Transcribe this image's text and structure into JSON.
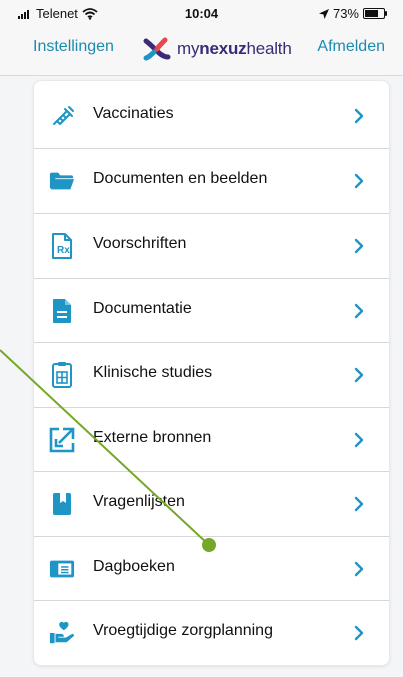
{
  "status_bar": {
    "carrier": "Telenet",
    "time": "10:04",
    "battery_percent": "73%",
    "battery_level": 0.73
  },
  "header": {
    "left_action": "Instellingen",
    "brand": {
      "my": "my",
      "nexuz": "nexuz",
      "health": "health"
    },
    "right_action": "Afmelden"
  },
  "menu": {
    "items": [
      {
        "label": "Vaccinaties",
        "icon": "syringe-icon"
      },
      {
        "label": "Documenten en beelden",
        "icon": "folder-icon"
      },
      {
        "label": "Voorschriften",
        "icon": "prescription-icon"
      },
      {
        "label": "Documentatie",
        "icon": "document-icon"
      },
      {
        "label": "Klinische studies",
        "icon": "clipboard-icon"
      },
      {
        "label": "Externe bronnen",
        "icon": "external-link-icon"
      },
      {
        "label": "Vragenlijsten",
        "icon": "bookmark-icon"
      },
      {
        "label": "Dagboeken",
        "icon": "journal-icon"
      },
      {
        "label": "Vroegtijdige zorgplanning",
        "icon": "heart-hand-icon"
      }
    ]
  },
  "colors": {
    "accent": "#1d8ab0",
    "icon": "#1f95c6",
    "annotation": "#76a728",
    "brand_purple": "#3b2b77",
    "brand_red": "#e5484d"
  }
}
